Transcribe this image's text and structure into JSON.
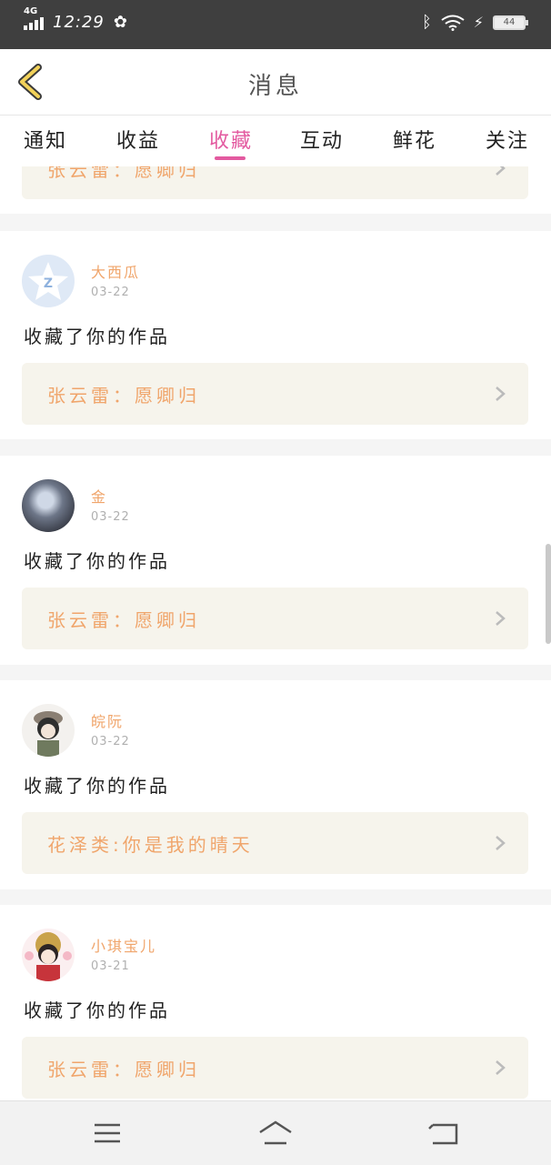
{
  "status_bar": {
    "network": "4G",
    "network_sup": "HD",
    "time": "12:29",
    "battery": "44"
  },
  "header": {
    "title": "消息"
  },
  "tabs": [
    {
      "label": "通知"
    },
    {
      "label": "收益"
    },
    {
      "label": "收藏"
    },
    {
      "label": "互动"
    },
    {
      "label": "鲜花"
    },
    {
      "label": "关注"
    }
  ],
  "active_tab": "收藏",
  "partial_item": {
    "work_title": "张云雷：愿卿归"
  },
  "items": [
    {
      "username": "大西瓜",
      "date": "03-22",
      "action": "收藏了你的作品",
      "work_title": "张云雷：愿卿归"
    },
    {
      "username": "金",
      "date": "03-22",
      "action": "收藏了你的作品",
      "work_title": "张云雷：愿卿归"
    },
    {
      "username": "皖阮",
      "date": "03-22",
      "action": "收藏了你的作品",
      "work_title": "花泽类:你是我的晴天"
    },
    {
      "username": "小琪宝儿",
      "date": "03-21",
      "action": "收藏了你的作品",
      "work_title": "张云雷：愿卿归"
    }
  ],
  "colors": {
    "accent": "#e35aa0",
    "username": "#f0a56b",
    "work_card_bg": "#f6f4ec"
  }
}
